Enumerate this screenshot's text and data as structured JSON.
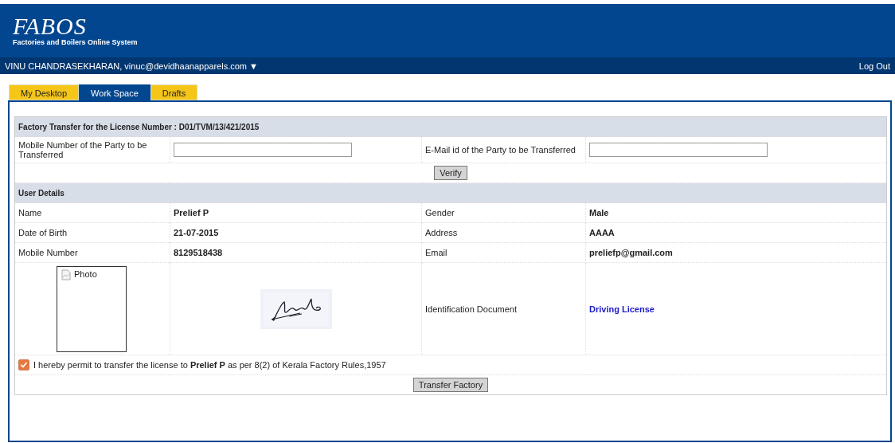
{
  "header": {
    "logo": "FABOS",
    "subtitle": "Factories and Boilers Online System"
  },
  "user_bar": {
    "user": "VINU CHANDRASEKHARAN, vinuc@devidhaanapparels.com",
    "caret": "▼",
    "logout": "Log Out"
  },
  "tabs": [
    {
      "label": "My Desktop",
      "selected": false
    },
    {
      "label": "Work Space",
      "selected": true
    },
    {
      "label": "Drafts",
      "selected": false
    }
  ],
  "form": {
    "title": "Factory Transfer for the License Number : D01/TVM/13/421/2015",
    "mobile_label": "Mobile Number of the Party to be Transferred",
    "email_label": "E-Mail id of the Party to be Transferred",
    "verify": "Verify"
  },
  "user_details": {
    "title": "User Details",
    "rows": [
      {
        "label": "Name",
        "value": "Prelief P",
        "label_2": "Gender",
        "value_2": "Male"
      },
      {
        "label": "Date of Birth",
        "value": "21-07-2015",
        "label_2": "Address",
        "value_2": "AAAA"
      },
      {
        "label": "Mobile Number",
        "value": "8129518438",
        "label_2": "Email",
        "value_2": "preliefp@gmail.com"
      }
    ],
    "photo_alt": "Photo",
    "document_label": "Identification Document",
    "document_link": "Driving License"
  },
  "consent": {
    "checked": true,
    "text": "I hereby permit to transfer the license to **Prelief P** as per 8(2) of Kerala Factory Rules,1957"
  },
  "transfer_button": "Transfer Factory"
}
